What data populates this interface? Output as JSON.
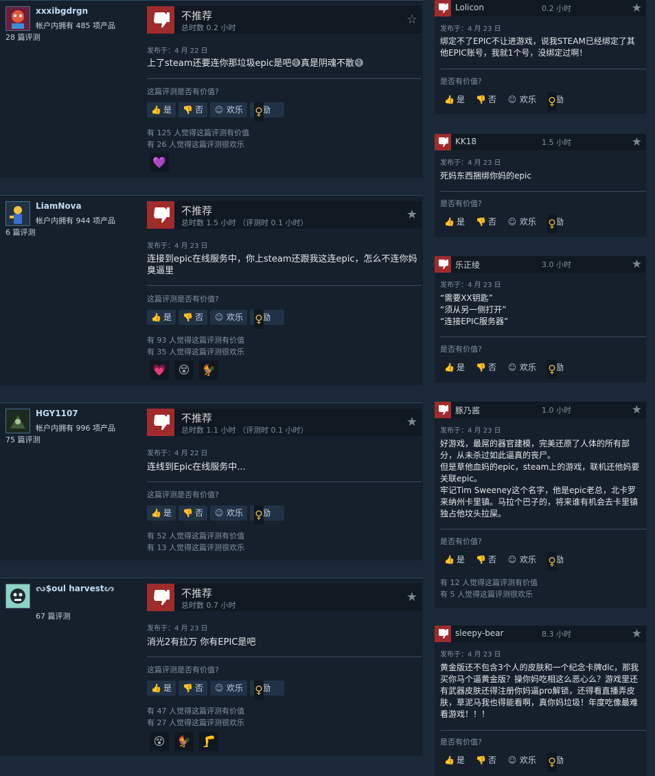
{
  "labels": {
    "not_recommended": "不推荐",
    "helpful_question": "这篇评测是否有价值?",
    "helpful_question_short": "是否有价值?",
    "yes": "是",
    "no": "否",
    "funny": "欢乐",
    "award": "奖励"
  },
  "colors": {
    "thumb_down_bg": "#a02b2b",
    "accent_blue": "#67c1f5",
    "award_gold": "#e9b43b"
  },
  "left_reviews": [
    {
      "persona": "xxxibgdrgn",
      "products": "帐户内拥有 485 项产品",
      "review_count": "28 篇评测",
      "hours": "总时数 0.2 小时",
      "posted": "发布于：4 月 22 日",
      "content": "上了steam还要连你那垃圾epic是吧😅真是阴魂不散😅",
      "helpful_stat": "有 125 人觉得这篇评测有价值",
      "funny_stat": "有 26 人觉得这篇评测很欢乐",
      "awards": [
        "💜"
      ]
    },
    {
      "persona": "LiamNova",
      "products": "帐户内拥有 944 项产品",
      "review_count": "6 篇评测",
      "hours": "总时数 1.5 小时  （评测时 0.1 小时）",
      "posted": "发布于：4 月 23 日",
      "content": "连接到epic在线服务中，你上steam还跟我这连epic，怎么不连你妈臭逼里",
      "helpful_stat": "有 93 人觉得这篇评测有价值",
      "funny_stat": "有 35 人觉得这篇评测很欢乐",
      "awards": [
        "💗",
        "😵",
        "🐓"
      ]
    },
    {
      "persona": "HGY1107",
      "products": "帐户内拥有 996 项产品",
      "review_count": "75 篇评测",
      "hours": "总时数 1.1 小时  （评测时 0.1 小时）",
      "posted": "发布于：4 月 22 日",
      "content": "连线到Epic在线服务中...",
      "helpful_stat": "有 52 人觉得这篇评测有价值",
      "funny_stat": "有 13 人觉得这篇评测很欢乐",
      "awards": []
    },
    {
      "persona": "$oul harvest",
      "products": "",
      "review_count": "67 篇评测",
      "hours": "总时数 0.7 小时",
      "posted": "发布于：4 月 23 日",
      "content": "消光2有拉万 你有EPIC是吧",
      "helpful_stat": "有 47 人觉得这篇评测有价值",
      "funny_stat": "有 27 人觉得这篇评测很欢乐",
      "awards": [
        "😵",
        "🐓",
        "🦵"
      ]
    }
  ],
  "right_reviews": [
    {
      "name": "Lolicon",
      "hours": "0.2 小时",
      "posted": "发布于：4 月 23 日",
      "content": "绑定不了EPIC不让进游戏，说我STEAM已经绑定了其他EPIC账号，我就1个号，没绑定过啊！",
      "helpful_stat": "",
      "funny_stat": ""
    },
    {
      "name": "KK18",
      "hours": "1.5 小时",
      "posted": "发布于：4 月 23 日",
      "content": "死妈东西捆绑你妈的epic",
      "helpful_stat": "",
      "funny_stat": ""
    },
    {
      "name": "乐正绫",
      "hours": "3.0 小时",
      "posted": "发布于：4 月 23 日",
      "content": "“需要XX钥匙”\n“须从另一侧打开”\n“连接EPIC服务器”",
      "helpful_stat": "",
      "funny_stat": ""
    },
    {
      "name": "豚乃酱",
      "hours": "1.0 小时",
      "posted": "发布于：4 月 23 日",
      "content": "好游戏，最屌的器官建模，完美还原了人体的所有部分，从未杀过如此逼真的丧尸。\n但是草他血妈的epic，steam上的游戏，联机还他妈要关联epic。\n牢记Tim Sweeney这个名字，他是epic老总，北卡罗来纳州卡里镇。马拉个巴子的，将来谁有机会去卡里镇独占他坟头拉屎。",
      "helpful_stat": "有 12 人觉得这篇评测有价值",
      "funny_stat": "有 5 人觉得这篇评测很欢乐"
    },
    {
      "name": "sleepy-bear",
      "hours": "8.3 小时",
      "posted": "发布于：4 月 23 日",
      "content": "黄金版还不包含3个人的皮肤和一个纪念卡牌dlc，那我买你马个逼黄金版？操你妈吃相这么恶心么？游戏里还有武器皮肤还得注册你妈逼pro解锁，还得看直播弄皮肤，草泥马我也得能看啊，真你妈垃圾！年度吃像最难看游戏！！！",
      "helpful_stat": "",
      "funny_stat": ""
    }
  ]
}
